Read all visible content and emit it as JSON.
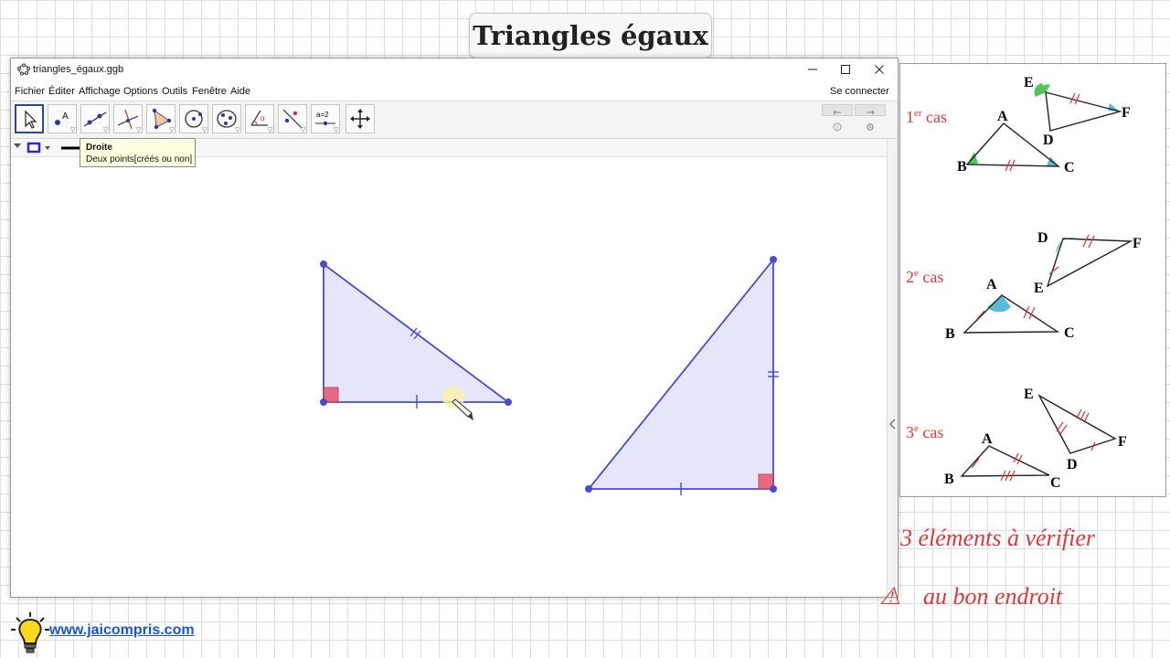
{
  "title_box": "Triangles égaux",
  "window": {
    "title": "triangles_égaux.ggb",
    "menu": [
      "Fichier",
      "Éditer",
      "Affichage",
      "Options",
      "Outils",
      "Fenêtre",
      "Aide"
    ],
    "connect": "Se connecter",
    "tools": [
      {
        "name": "move-tool-icon",
        "selected": true
      },
      {
        "name": "point-tool-icon"
      },
      {
        "name": "line-tool-icon"
      },
      {
        "name": "perpendicular-tool-icon"
      },
      {
        "name": "polygon-tool-icon"
      },
      {
        "name": "circle-tool-icon"
      },
      {
        "name": "conic-tool-icon"
      },
      {
        "name": "angle-tool-icon"
      },
      {
        "name": "reflect-tool-icon"
      },
      {
        "name": "slider-tool-icon",
        "label": "a=2"
      },
      {
        "name": "move-view-tool-icon"
      }
    ],
    "tooltip": {
      "title": "Droite",
      "text": "Deux points[créés ou non]"
    }
  },
  "cases": {
    "case1": {
      "num": "1",
      "sup": "er",
      "word": "cas",
      "pts": [
        "E",
        "F",
        "A",
        "D",
        "B",
        "C"
      ]
    },
    "case2": {
      "num": "2",
      "sup": "e",
      "word": "cas",
      "pts": [
        "D",
        "F",
        "E",
        "A",
        "B",
        "C"
      ]
    },
    "case3": {
      "num": "3",
      "sup": "e",
      "word": "cas",
      "pts": [
        "E",
        "A",
        "F",
        "D",
        "B",
        "C"
      ]
    }
  },
  "handwriting": {
    "line1": "3 éléments à vérifier",
    "line2": "au bon endroit",
    "warn": "⚠"
  },
  "footer": {
    "url": "www.jaicompris.com"
  },
  "colors": {
    "fill": "#e6e6fa",
    "stroke": "#4b4bcf",
    "right_angle": "#e6566a",
    "annotation": "#d43c3c",
    "green": "#57c45a",
    "blue": "#5bbad9"
  }
}
